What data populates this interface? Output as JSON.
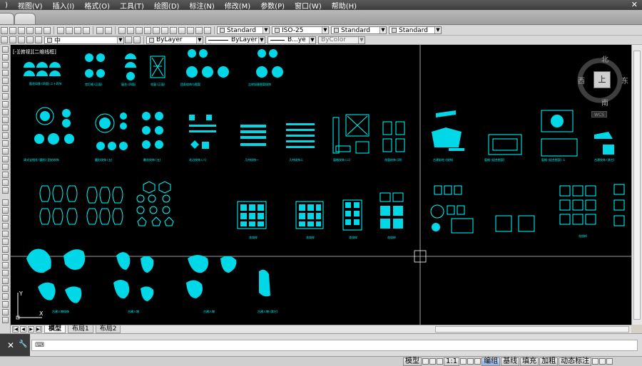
{
  "menu": {
    "items": [
      "视图(V)",
      "插入(I)",
      "格式(O)",
      "工具(T)",
      "绘图(D)",
      "标注(N)",
      "修改(M)",
      "参数(P)",
      "窗口(W)",
      "帮助(H)"
    ],
    "leading": ")"
  },
  "toolbar": {
    "text_style": "Standard",
    "dim_style": "ISO-25",
    "table_style": "Standard",
    "multileader_style": "Standard",
    "layer": "中",
    "color": "ByLayer",
    "linetype": "ByLayer",
    "lineweight": "B...ye",
    "plotstyle": "ByColor"
  },
  "canvas": {
    "view_label": "[-][俯视][二维线框]",
    "background": "#000000",
    "entity_color": "#00ffff",
    "captions": {
      "c1": "窗花如意 (四面) 二十四节",
      "c2": "宫灯格 (正面)",
      "c3": "窗花 (四面)",
      "c4": "花窗 (正面)",
      "c5": "团寿纹饰与图案",
      "c6": "吉祥如意图案纹饰",
      "c7": "清式宝相花 (圆形) 团花纹饰",
      "c8": "圆形纹饰 (五)",
      "c9": "雕花纹饰 (五)",
      "c10": "花边纹饰 (八)",
      "c11": "几何纹饰一",
      "c12": "几何纹饰二",
      "c13": "窗格纹饰 (二)",
      "c14": "花窗纹饰 (四)",
      "c15": "古建彩绘 (纹饰)",
      "c16": "窗格 (组合图案)",
      "c17": "窗格 (组合图案) 二",
      "c18": "古建纹饰 (其它)",
      "c19": "花纹样",
      "c20": "古建人物纹饰",
      "c21": "古建人物",
      "c22": "古建人物",
      "c23": "古建人物 (其它)"
    }
  },
  "viewcube": {
    "north": "北",
    "south": "南",
    "west": "西",
    "east": "东",
    "top": "上",
    "wcs": "WCS"
  },
  "layout_tabs": [
    "模型",
    "布局1",
    "布局2"
  ],
  "command": {
    "close_icon": "✕",
    "wrench_icon": "🔧",
    "prompt_icon": "⌨"
  },
  "status": {
    "model_label": "模型",
    "scale": "1:1",
    "toggles": [
      "编组",
      "基线",
      "填充",
      "加粗",
      "动态标注"
    ]
  }
}
